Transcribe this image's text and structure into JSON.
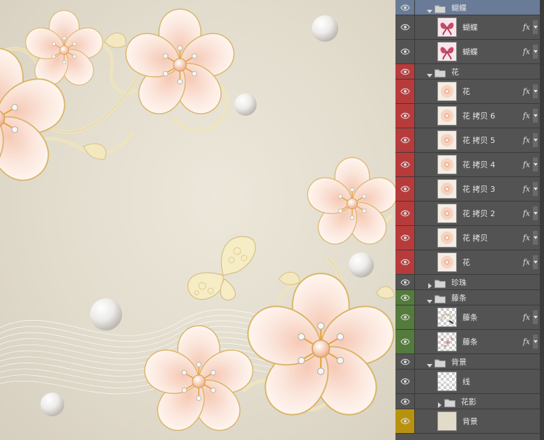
{
  "colors": {
    "panel_bg": "#535353",
    "row_selected": "#6a7b97",
    "label_red": "#b73b3b",
    "label_green": "#547a3c",
    "label_yellow": "#b8920e",
    "canvas_bg": "#e6e1d3"
  },
  "layers": [
    {
      "id": "butterfly-group",
      "type": "group",
      "name": "蝴蝶",
      "expanded": true,
      "depth": 0,
      "label": "selected",
      "fx": false,
      "thumb": ""
    },
    {
      "id": "butterfly-1",
      "type": "layer",
      "name": "蝴蝶",
      "depth": 1,
      "label": "none",
      "fx": true,
      "thumb": "butterfly",
      "smart": true
    },
    {
      "id": "butterfly-2",
      "type": "layer",
      "name": "蝴蝶",
      "depth": 1,
      "label": "none",
      "fx": true,
      "thumb": "butterfly",
      "smart": true
    },
    {
      "id": "flower-group",
      "type": "group",
      "name": "花",
      "expanded": true,
      "depth": 0,
      "label": "red",
      "fx": false,
      "thumb": ""
    },
    {
      "id": "flower",
      "type": "layer",
      "name": "花",
      "depth": 1,
      "label": "red",
      "fx": true,
      "thumb": "flower"
    },
    {
      "id": "flower-copy-6",
      "type": "layer",
      "name": "花 拷贝 6",
      "depth": 1,
      "label": "red",
      "fx": true,
      "thumb": "flower"
    },
    {
      "id": "flower-copy-5",
      "type": "layer",
      "name": "花 拷贝 5",
      "depth": 1,
      "label": "red",
      "fx": true,
      "thumb": "flower"
    },
    {
      "id": "flower-copy-4",
      "type": "layer",
      "name": "花 拷贝 4",
      "depth": 1,
      "label": "red",
      "fx": true,
      "thumb": "flower"
    },
    {
      "id": "flower-copy-3",
      "type": "layer",
      "name": "花 拷贝 3",
      "depth": 1,
      "label": "red",
      "fx": true,
      "thumb": "flower"
    },
    {
      "id": "flower-copy-2",
      "type": "layer",
      "name": "花 拷贝 2",
      "depth": 1,
      "label": "red",
      "fx": true,
      "thumb": "flower"
    },
    {
      "id": "flower-copy",
      "type": "layer",
      "name": "花 拷贝",
      "depth": 1,
      "label": "red",
      "fx": true,
      "thumb": "flower"
    },
    {
      "id": "flower-b",
      "type": "layer",
      "name": "花",
      "depth": 1,
      "label": "red",
      "fx": true,
      "thumb": "flower"
    },
    {
      "id": "pearl-group",
      "type": "group",
      "name": "珍珠",
      "expanded": false,
      "depth": 0,
      "label": "none",
      "fx": false,
      "thumb": ""
    },
    {
      "id": "vine-group",
      "type": "group",
      "name": "藤条",
      "expanded": true,
      "depth": 0,
      "label": "green",
      "fx": false,
      "thumb": ""
    },
    {
      "id": "vine-1",
      "type": "layer",
      "name": "藤条",
      "depth": 1,
      "label": "green",
      "fx": true,
      "thumb": "vine",
      "smart": true
    },
    {
      "id": "vine-2",
      "type": "layer",
      "name": "藤条",
      "depth": 1,
      "label": "green",
      "fx": true,
      "thumb": "vine2"
    },
    {
      "id": "bg-group",
      "type": "group",
      "name": "背景",
      "expanded": true,
      "depth": 0,
      "label": "none",
      "fx": false,
      "thumb": ""
    },
    {
      "id": "lines",
      "type": "layer",
      "name": "线",
      "depth": 1,
      "label": "none",
      "fx": false,
      "thumb": "lines"
    },
    {
      "id": "flower-shadow-group",
      "type": "group",
      "name": "花影",
      "expanded": false,
      "depth": 1,
      "label": "none",
      "fx": false,
      "thumb": ""
    },
    {
      "id": "background",
      "type": "layer",
      "name": "背景",
      "depth": 1,
      "label": "yellow",
      "fx": false,
      "thumb": "bg"
    }
  ],
  "fx_label": "fx"
}
